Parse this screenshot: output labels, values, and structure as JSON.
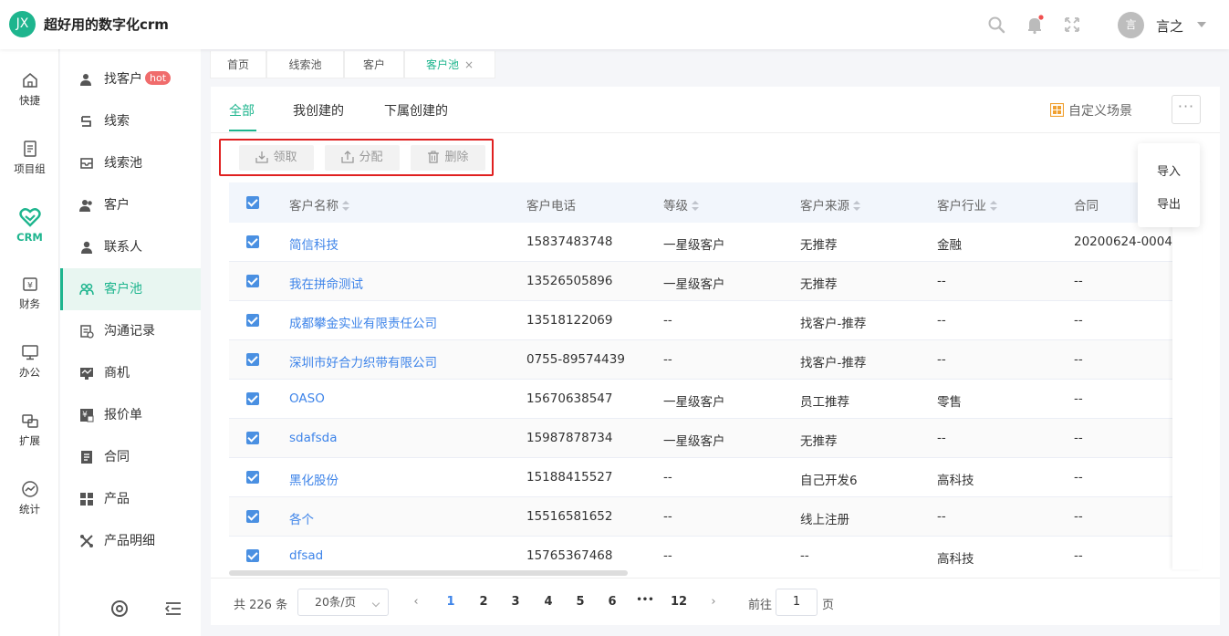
{
  "app": {
    "logo_text": "JX",
    "title": "超好用的数字化crm"
  },
  "user": {
    "avatar_text": "言",
    "name": "言之"
  },
  "rail": [
    {
      "label": "快捷",
      "icon": "home-icon"
    },
    {
      "label": "项目组",
      "icon": "document-icon"
    },
    {
      "label": "CRM",
      "icon": "heart-icon",
      "active": true
    },
    {
      "label": "财务",
      "icon": "wallet-icon"
    },
    {
      "label": "办公",
      "icon": "monitor-icon"
    },
    {
      "label": "扩展",
      "icon": "extension-icon"
    },
    {
      "label": "统计",
      "icon": "chart-circle-icon"
    }
  ],
  "submenu": [
    {
      "label": "找客户",
      "badge": "hot",
      "icon": "find-customer-icon"
    },
    {
      "label": "线索",
      "icon": "lead-icon"
    },
    {
      "label": "线索池",
      "icon": "lead-pool-icon"
    },
    {
      "label": "客户",
      "icon": "customer-icon"
    },
    {
      "label": "联系人",
      "icon": "contact-icon"
    },
    {
      "label": "客户池",
      "icon": "customer-pool-icon",
      "active": true
    },
    {
      "label": "沟通记录",
      "icon": "communication-icon"
    },
    {
      "label": "商机",
      "icon": "opportunity-icon"
    },
    {
      "label": "报价单",
      "icon": "quote-icon"
    },
    {
      "label": "合同",
      "icon": "contract-icon"
    },
    {
      "label": "产品",
      "icon": "product-icon"
    },
    {
      "label": "产品明细",
      "icon": "product-detail-icon"
    }
  ],
  "page_tabs": [
    {
      "label": "首页"
    },
    {
      "label": "线索池"
    },
    {
      "label": "客户"
    },
    {
      "label": "客户池",
      "active": true,
      "close": "×"
    }
  ],
  "view_tabs": [
    {
      "label": "全部",
      "active": true
    },
    {
      "label": "我创建的"
    },
    {
      "label": "下属创建的"
    }
  ],
  "toolbar": {
    "scene_label": "自定义场景",
    "more_label": "···",
    "claim_label": "领取",
    "assign_label": "分配",
    "delete_label": "删除"
  },
  "more_menu": [
    {
      "label": "导入"
    },
    {
      "label": "导出"
    }
  ],
  "table": {
    "columns": [
      "客户名称",
      "客户电话",
      "等级",
      "客户来源",
      "客户行业",
      "合同"
    ],
    "rows": [
      [
        "简信科技",
        "15837483748",
        "一星级客户",
        "无推荐",
        "金融",
        "20200624-0004"
      ],
      [
        "我在拼命测试",
        "13526505896",
        "一星级客户",
        "无推荐",
        "--",
        "--"
      ],
      [
        "成都攀金实业有限责任公司",
        "13518122069",
        "--",
        "找客户-推荐",
        "--",
        "--"
      ],
      [
        "深圳市好合力织带有限公司",
        "0755-89574439",
        "--",
        "找客户-推荐",
        "--",
        "--"
      ],
      [
        "OASO",
        "15670638547",
        "一星级客户",
        "员工推荐",
        "零售",
        "--"
      ],
      [
        "sdafsda",
        "15987878734",
        "一星级客户",
        "无推荐",
        "--",
        "--"
      ],
      [
        "黑化股份",
        "15188415527",
        "--",
        "自己开发6",
        "高科技",
        "--"
      ],
      [
        "各个",
        "15516581652",
        "--",
        "线上注册",
        "--",
        "--"
      ],
      [
        "dfsad",
        "15765367468",
        "--",
        "--",
        "高科技",
        "--"
      ]
    ]
  },
  "pagination": {
    "total": "共 226 条",
    "page_size": "20条/页",
    "pages": [
      "1",
      "2",
      "3",
      "4",
      "5",
      "6",
      "•••",
      "12"
    ],
    "prev": "‹",
    "next": "›",
    "goto_label": "前往",
    "goto_value": "1",
    "goto_unit": "页"
  },
  "colors": {
    "accent": "#1eb58e",
    "link": "#3e84e9",
    "highlight_box": "#e02020",
    "hot_badge": "#f06c6c"
  }
}
